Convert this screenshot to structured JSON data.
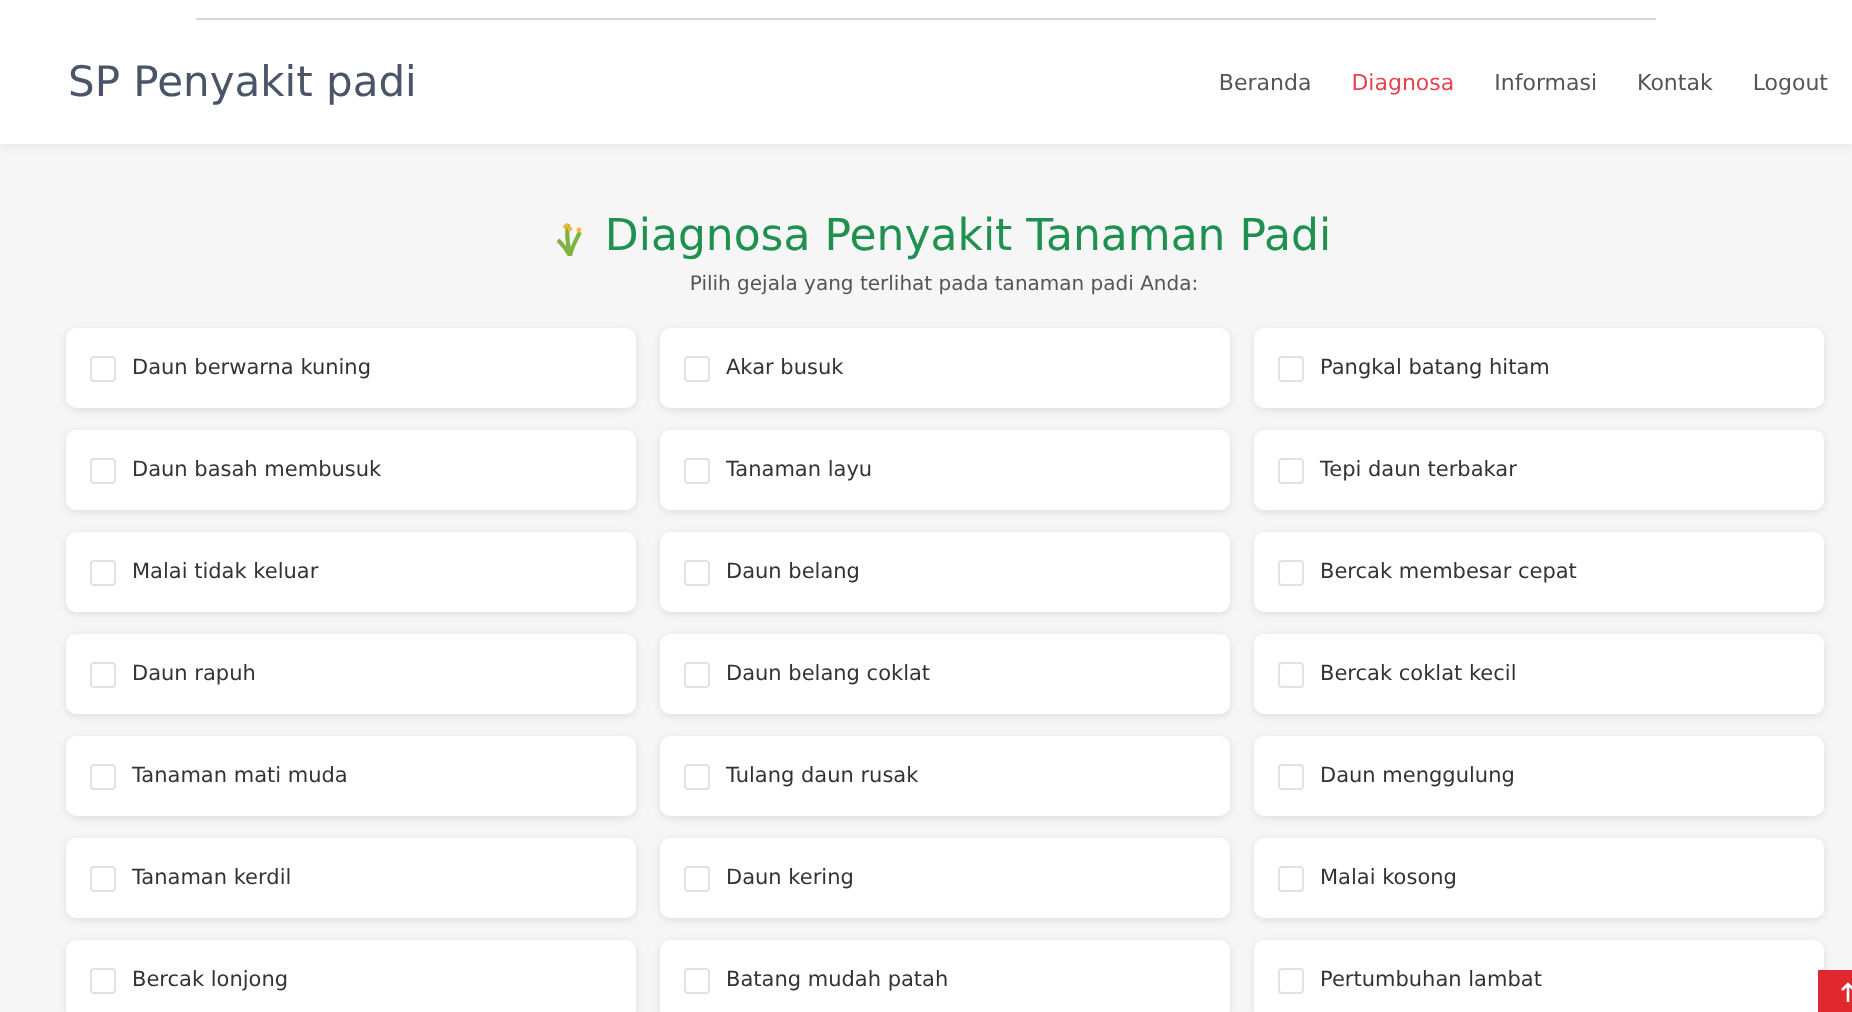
{
  "brand": "SP Penyakit padi",
  "nav": [
    {
      "label": "Beranda",
      "selected": false
    },
    {
      "label": "Diagnosa",
      "selected": true
    },
    {
      "label": "Informasi",
      "selected": false
    },
    {
      "label": "Kontak",
      "selected": false
    },
    {
      "label": "Logout",
      "selected": false
    }
  ],
  "heading": {
    "title": "Diagnosa Penyakit Tanaman Padi",
    "subtitle": "Pilih gejala yang terlihat pada tanaman padi Anda:"
  },
  "symptoms": [
    {
      "label": "Daun berwarna kuning",
      "checked": false
    },
    {
      "label": "Akar busuk",
      "checked": false
    },
    {
      "label": "Pangkal batang hitam",
      "checked": false
    },
    {
      "label": "Daun basah membusuk",
      "checked": false
    },
    {
      "label": "Tanaman layu",
      "checked": false
    },
    {
      "label": "Tepi daun terbakar",
      "checked": false
    },
    {
      "label": "Malai tidak keluar",
      "checked": false
    },
    {
      "label": "Daun belang",
      "checked": false
    },
    {
      "label": "Bercak membesar cepat",
      "checked": false
    },
    {
      "label": "Daun rapuh",
      "checked": false
    },
    {
      "label": "Daun belang coklat",
      "checked": false
    },
    {
      "label": "Bercak coklat kecil",
      "checked": false
    },
    {
      "label": "Tanaman mati muda",
      "checked": false
    },
    {
      "label": "Tulang daun rusak",
      "checked": false
    },
    {
      "label": "Daun menggulung",
      "checked": false
    },
    {
      "label": "Tanaman kerdil",
      "checked": false
    },
    {
      "label": "Daun kering",
      "checked": false
    },
    {
      "label": "Malai kosong",
      "checked": false
    },
    {
      "label": "Bercak lonjong",
      "checked": false
    },
    {
      "label": "Batang mudah patah",
      "checked": false
    },
    {
      "label": "Pertumbuhan lambat",
      "checked": false
    }
  ]
}
